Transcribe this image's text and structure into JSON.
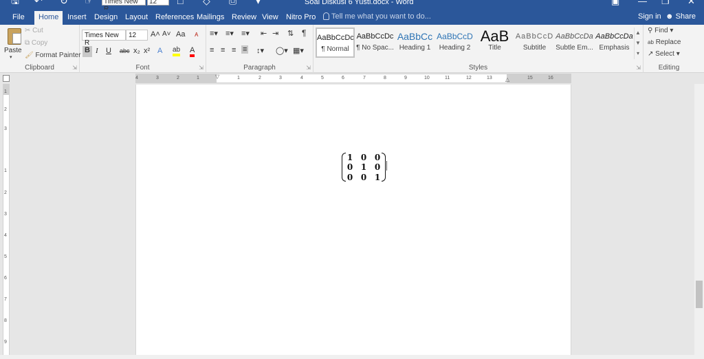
{
  "titlebar": {
    "doc_title": "Soal Diskusi 6 Yusti.docx - Word",
    "qa_font_name": "Times New R",
    "qa_font_size": "12"
  },
  "tabs": [
    {
      "label": "File"
    },
    {
      "label": "Home",
      "active": true
    },
    {
      "label": "Insert"
    },
    {
      "label": "Design"
    },
    {
      "label": "Layout"
    },
    {
      "label": "References"
    },
    {
      "label": "Mailings"
    },
    {
      "label": "Review"
    },
    {
      "label": "View"
    },
    {
      "label": "Nitro Pro"
    }
  ],
  "tell_me": {
    "placeholder": "Tell me what you want to do..."
  },
  "account": {
    "sign_in": "Sign in",
    "share": "Share"
  },
  "clipboard": {
    "label": "Clipboard",
    "paste": "Paste",
    "cut": "Cut",
    "copy": "Copy",
    "format_painter": "Format Painter"
  },
  "font": {
    "label": "Font",
    "name": "Times New R",
    "size": "12",
    "grow": "A˄",
    "shrink": "A˅",
    "case": "Aa",
    "clear": "ᴀ",
    "bold": "B",
    "italic": "I",
    "underline": "U",
    "strike": "abc",
    "subscript": "x₂",
    "superscript": "x²",
    "effects": "A",
    "highlight": "ab",
    "color": "A"
  },
  "paragraph": {
    "label": "Paragraph",
    "pilcrow": "¶"
  },
  "styles": {
    "label": "Styles",
    "items": [
      {
        "preview": "AaBbCcDc",
        "name": "¶ Normal",
        "selected": true
      },
      {
        "preview": "AaBbCcDc",
        "name": "¶ No Spac..."
      },
      {
        "preview": "AaBbCc",
        "name": "Heading 1"
      },
      {
        "preview": "AaBbCcD",
        "name": "Heading 2"
      },
      {
        "preview": "AaB",
        "name": "Title"
      },
      {
        "preview": "AaBbCcD",
        "name": "Subtitle"
      },
      {
        "preview": "AaBbCcDa",
        "name": "Subtle Em..."
      },
      {
        "preview": "AaBbCcDa",
        "name": "Emphasis"
      }
    ]
  },
  "editing": {
    "label": "Editing",
    "find": "Find",
    "replace": "Replace",
    "select": "Select"
  },
  "ruler": {
    "h_ticks": [
      "4",
      "3",
      "2",
      "1",
      "1",
      "2",
      "3",
      "4",
      "5",
      "6",
      "7",
      "8",
      "9",
      "10",
      "11",
      "12",
      "13",
      "15",
      "16"
    ],
    "v_ticks": [
      "1",
      "2",
      "3",
      "1",
      "2",
      "3",
      "4",
      "5",
      "6",
      "7",
      "8",
      "9"
    ]
  },
  "document": {
    "matrix": [
      [
        "1",
        "0",
        "0"
      ],
      [
        "0",
        "1",
        "0"
      ],
      [
        "0",
        "0",
        "1"
      ]
    ]
  },
  "colors": {
    "accent": "#2b579a",
    "highlight_bar": "#ffff00",
    "font_color_bar": "#ff0000"
  }
}
